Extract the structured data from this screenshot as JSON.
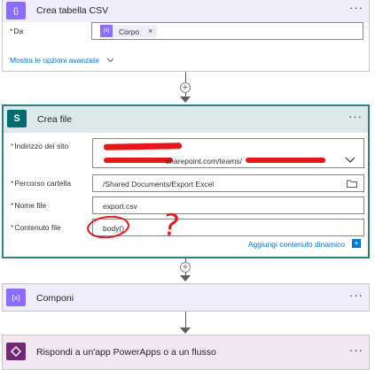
{
  "card_csv": {
    "title": "Crea tabella CSV",
    "da_label": "Da",
    "token_label": "Corpo",
    "token_remove": "×",
    "advanced_label": "Mostra le opzioni avanzate"
  },
  "card_crea_file": {
    "icon_letter": "S",
    "title": "Crea file",
    "fields": {
      "site_label": "Indirizzo del sito",
      "site_value": "sharepoint.com/teams/",
      "folder_label": "Percorso cartella",
      "folder_value": "/Shared Documents/Export Excel",
      "filename_label": "Nome file",
      "filename_value": "export.csv",
      "content_label": "Contenuto file",
      "content_value": "body()"
    },
    "dynamic_link": "Aggiungi contenuto dinamico",
    "annotation_question": "?"
  },
  "card_componi": {
    "title": "Componi"
  },
  "card_rispondi": {
    "title": "Rispondi a un'app PowerApps o a un flusso"
  },
  "common": {
    "dots": "···",
    "plus": "+",
    "required": "*"
  },
  "colors": {
    "csv_accent": "#8c6cff",
    "sharepoint_teal": "#036c70",
    "selected_border": "#2c7f86",
    "componi_accent": "#8c6cff",
    "powerapps": "#742774",
    "link": "#0078d4",
    "annotation_red": "#e6161a"
  }
}
